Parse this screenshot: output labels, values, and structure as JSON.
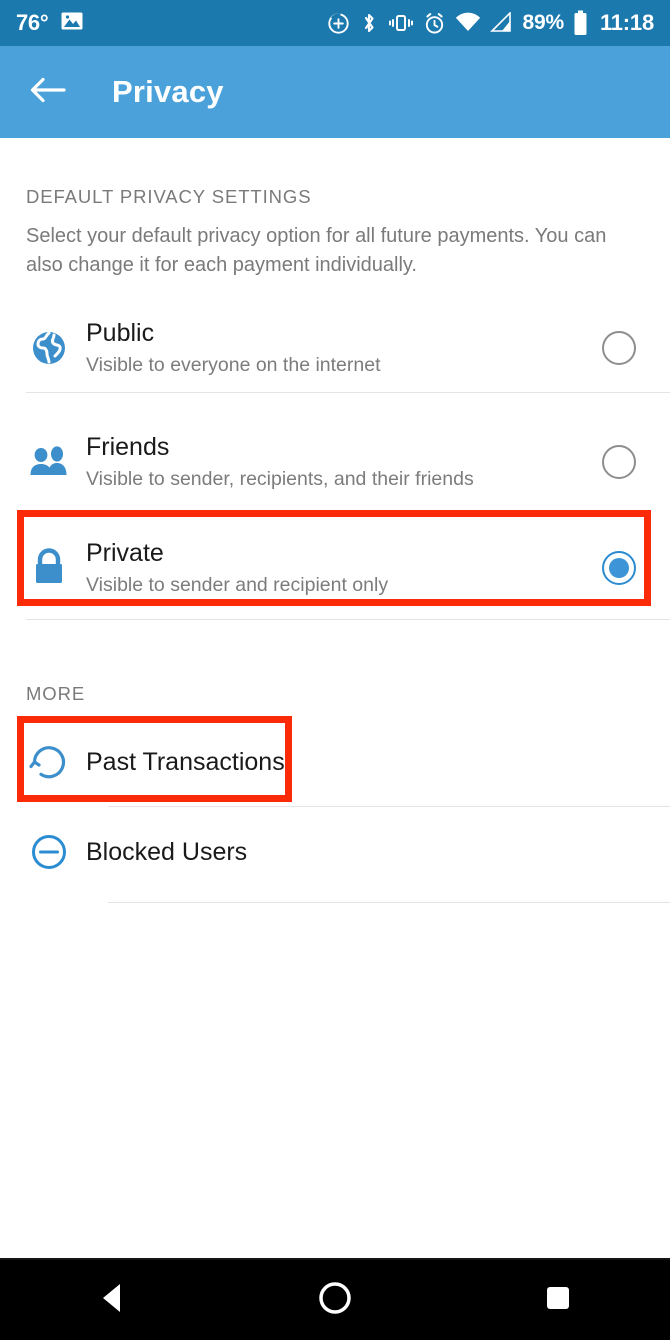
{
  "status_bar": {
    "temperature": "76°",
    "photo_icon": "image-icon",
    "icons": [
      "do-not-disturb-icon",
      "bluetooth-icon",
      "vibrate-icon",
      "alarm-icon",
      "wifi-icon",
      "cellular-signal-icon"
    ],
    "battery_percent": "89%",
    "battery_icon": "battery-icon",
    "clock": "11:18",
    "background_color": "#1B79AE"
  },
  "app_bar": {
    "back_icon": "back-arrow-icon",
    "title": "Privacy",
    "background_color": "#4BA2DB"
  },
  "default_section": {
    "header": "DEFAULT PRIVACY SETTINGS",
    "description": "Select your default privacy option for all future payments. You can also change it for each payment individually.",
    "options": [
      {
        "id": "public",
        "icon": "globe-icon",
        "title": "Public",
        "subtitle": "Visible to everyone on the internet",
        "selected": false
      },
      {
        "id": "friends",
        "icon": "people-icon",
        "title": "Friends",
        "subtitle": "Visible to sender, recipients, and their friends",
        "selected": false
      },
      {
        "id": "private",
        "icon": "lock-icon",
        "title": "Private",
        "subtitle": "Visible to sender and recipient only",
        "selected": true
      }
    ]
  },
  "more_section": {
    "header": "MORE",
    "items": [
      {
        "id": "past-transactions",
        "icon": "history-icon",
        "title": "Past Transactions"
      },
      {
        "id": "blocked-users",
        "icon": "block-circle-minus-icon",
        "title": "Blocked Users"
      }
    ]
  },
  "annotations": {
    "highlight_color": "#FB2A09",
    "boxes": [
      "private-option-row",
      "past-transactions-row"
    ]
  },
  "nav_bar": {
    "back": "nav-back-icon",
    "home": "nav-home-icon",
    "recents": "nav-recents-icon",
    "background_color": "#000000"
  },
  "theme": {
    "accent_blue": "#3D94D6",
    "icon_blue": "#3D8FCC",
    "text_primary": "#1A1A1A",
    "text_secondary": "#7C7C7C"
  }
}
